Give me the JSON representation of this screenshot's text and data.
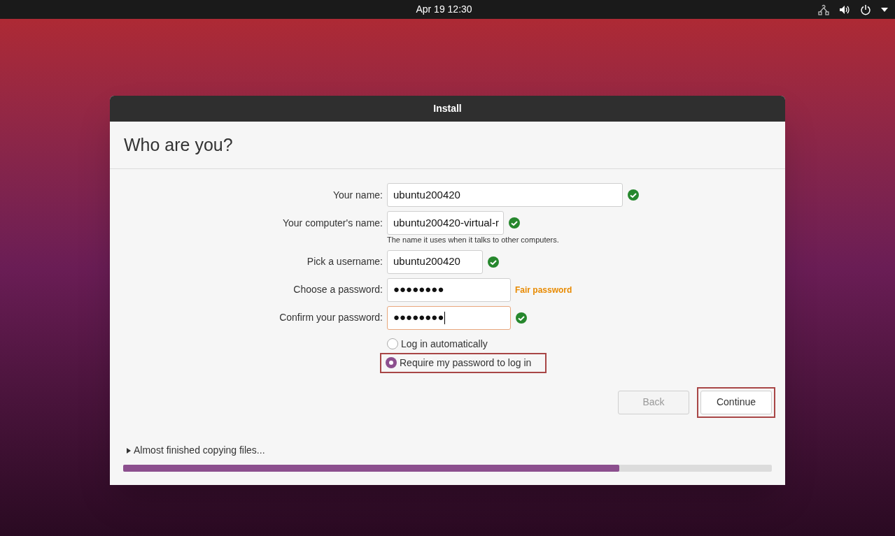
{
  "top_bar": {
    "clock": "Apr 19  12:30"
  },
  "window": {
    "title": "Install",
    "heading": "Who are you?"
  },
  "fields": [
    {
      "label": "Your name:",
      "value": "ubuntu200420",
      "valid": true,
      "focused": false
    },
    {
      "label": "Your computer's name:",
      "value": "ubuntu200420-virtual-r",
      "valid": true,
      "focused": false,
      "hint": "The name it uses when it talks to other computers."
    },
    {
      "label": "Pick a username:",
      "value": "ubuntu200420",
      "valid": true,
      "focused": false
    },
    {
      "label": "Choose a password:",
      "value": "●●●●●●●●",
      "valid": false,
      "focused": false,
      "strength": "Fair password"
    },
    {
      "label": "Confirm your password:",
      "value": "●●●●●●●●",
      "valid": true,
      "focused": true
    }
  ],
  "login_options": [
    {
      "label": "Log in automatically",
      "selected": false,
      "highlighted": false
    },
    {
      "label": "Require my password to log in",
      "selected": true,
      "highlighted": true
    }
  ],
  "buttons": [
    {
      "label": "Back",
      "disabled": true,
      "highlighted": false
    },
    {
      "label": "Continue",
      "disabled": false,
      "highlighted": true
    }
  ],
  "progress": {
    "status": "Almost finished copying files...",
    "level": 0.765
  }
}
